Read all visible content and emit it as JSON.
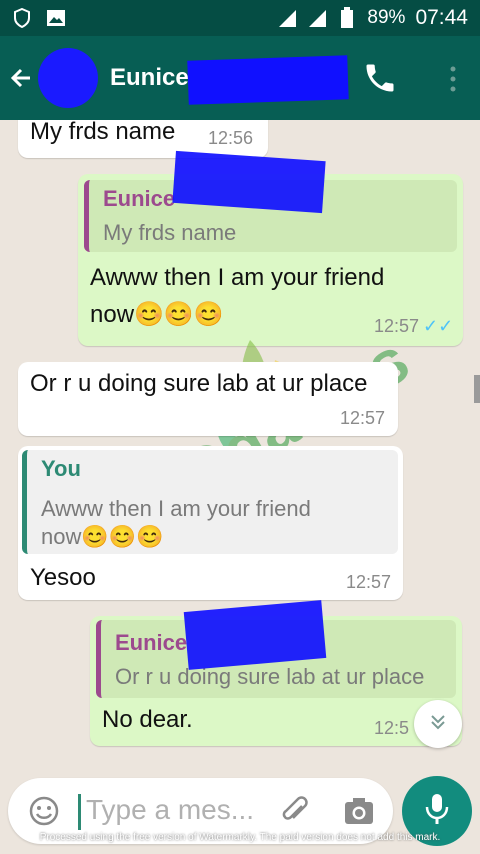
{
  "status_bar": {
    "battery": "89%",
    "time": "07:44"
  },
  "header": {
    "contact_name": "Eunice"
  },
  "messages": [
    {
      "text": "My frds name",
      "time": "12:56"
    },
    {
      "quote_author": "Eunice",
      "quote_text": "My frds name",
      "text_line1": "Awww then I am your friend",
      "text_line2": "now",
      "emoji": "😊😊😊",
      "time": "12:57"
    },
    {
      "text": "Or r u doing sure lab at ur place",
      "time": "12:57"
    },
    {
      "quote_author": "You",
      "quote_text_line1": "Awww then I am your friend",
      "quote_text_line2": "now",
      "quote_emoji": "😊😊😊",
      "text": "Yesoo",
      "time": "12:57"
    },
    {
      "quote_author": "Eunice",
      "quote_text": "Or r u doing sure lab at ur place",
      "text": "No dear.",
      "time": "12:5"
    }
  ],
  "input": {
    "placeholder": "Type a mes..."
  },
  "footer_note": "Processed using the free version of Watermarkly. The paid version does not add this mark.",
  "colors": {
    "header": "#075e54",
    "statusbar": "#054d44",
    "outgoing_bubble": "#dcf8c6",
    "incoming_bubble": "#ffffff",
    "mic_button": "#128c7e",
    "read_ticks": "#4fc3f7"
  },
  "icons": {
    "back": "arrow-left-icon",
    "call": "phone-icon",
    "more": "more-vert-icon",
    "emoji": "emoji-icon",
    "attach": "paperclip-icon",
    "camera": "camera-icon",
    "mic": "microphone-icon",
    "scroll": "double-chevron-down-icon"
  }
}
